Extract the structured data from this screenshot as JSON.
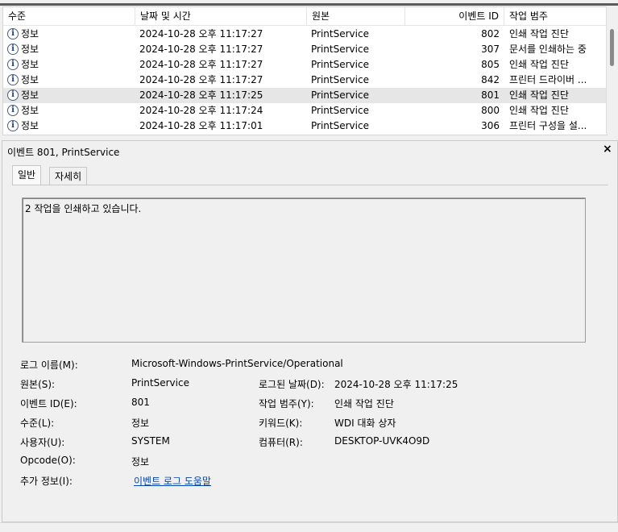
{
  "list": {
    "headers": {
      "level": "수준",
      "datetime": "날짜 및 시간",
      "source": "원본",
      "event_id": "이벤트 ID",
      "task_category": "작업 범주"
    },
    "rows": [
      {
        "level": "정보",
        "datetime": "2024-10-28 오후 11:17:27",
        "source": "PrintService",
        "event_id": "802",
        "task_category": "인쇄 작업 진단"
      },
      {
        "level": "정보",
        "datetime": "2024-10-28 오후 11:17:27",
        "source": "PrintService",
        "event_id": "307",
        "task_category": "문서를 인쇄하는 중"
      },
      {
        "level": "정보",
        "datetime": "2024-10-28 오후 11:17:27",
        "source": "PrintService",
        "event_id": "805",
        "task_category": "인쇄 작업 진단"
      },
      {
        "level": "정보",
        "datetime": "2024-10-28 오후 11:17:27",
        "source": "PrintService",
        "event_id": "842",
        "task_category": "프린터 드라이버 ..."
      },
      {
        "level": "정보",
        "datetime": "2024-10-28 오후 11:17:25",
        "source": "PrintService",
        "event_id": "801",
        "task_category": "인쇄 작업 진단"
      },
      {
        "level": "정보",
        "datetime": "2024-10-28 오후 11:17:24",
        "source": "PrintService",
        "event_id": "800",
        "task_category": "인쇄 작업 진단"
      },
      {
        "level": "정보",
        "datetime": "2024-10-28 오후 11:17:01",
        "source": "PrintService",
        "event_id": "306",
        "task_category": "프린터 구성을 설..."
      }
    ],
    "info_icon": "i"
  },
  "details": {
    "title": "이벤트 801, PrintService",
    "close": "×",
    "tabs": [
      "일반",
      "자세히"
    ],
    "description": "2 작업을 인쇄하고 있습니다.",
    "fields": {
      "log_name_label": "로그 이름(M):",
      "log_name_value": "Microsoft-Windows-PrintService/Operational",
      "source_label": "원본(S):",
      "source_value": "PrintService",
      "logged_label": "로그된 날짜(D):",
      "logged_value": "2024-10-28 오후 11:17:25",
      "event_id_label": "이벤트 ID(E):",
      "event_id_value": "801",
      "task_label": "작업 범주(Y):",
      "task_value": "인쇄 작업 진단",
      "level_label": "수준(L):",
      "level_value": "정보",
      "keywords_label": "키워드(K):",
      "keywords_value": "WDI 대화 상자",
      "user_label": "사용자(U):",
      "user_value": "SYSTEM",
      "computer_label": "컴퓨터(R):",
      "computer_value": "DESKTOP-UVK4O9D",
      "opcode_label": "Opcode(O):",
      "opcode_value": "정보",
      "more_info_label": "추가 정보(I):",
      "more_info_link": "이벤트 로그 도움말"
    }
  }
}
